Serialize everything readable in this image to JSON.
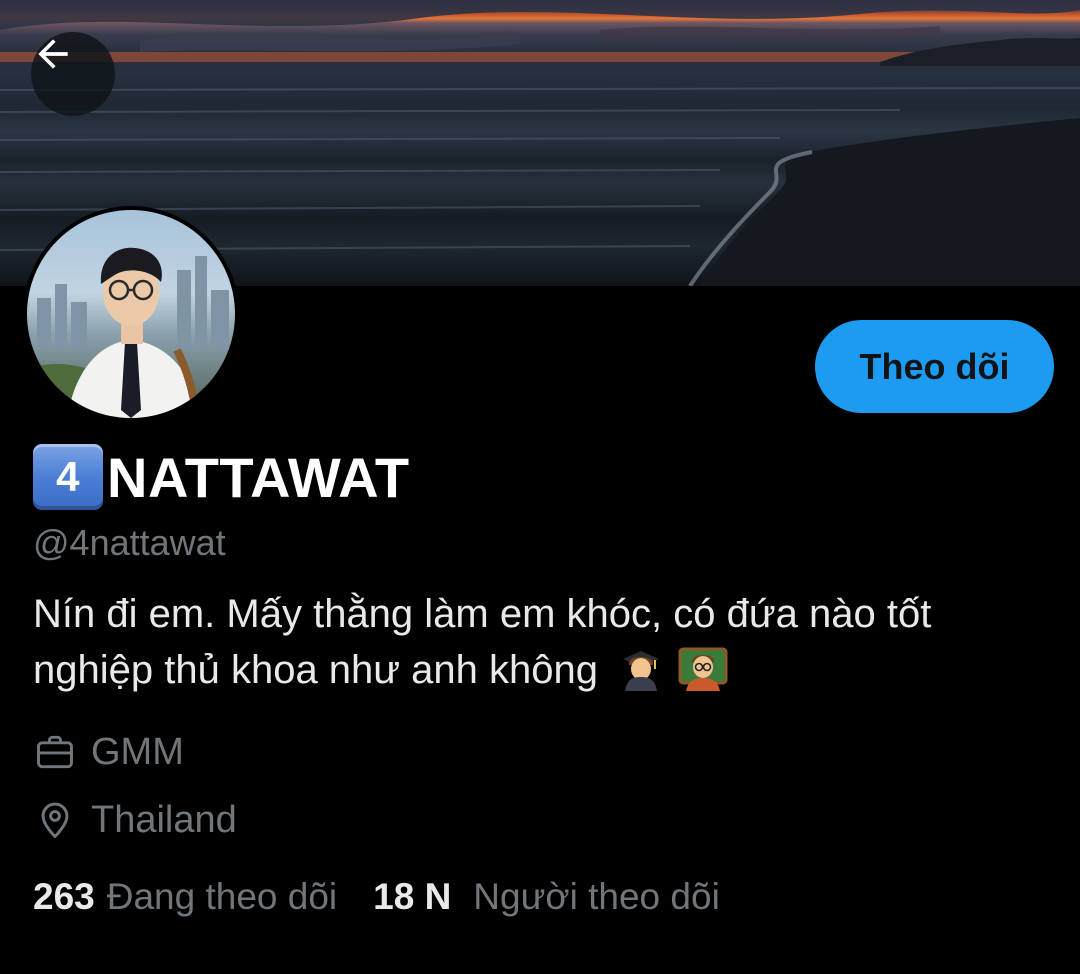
{
  "header": {
    "back_icon": "arrow-left-icon"
  },
  "banner": {
    "scene": "sunset over sea and beach"
  },
  "profile": {
    "follow_label": "Theo dõi",
    "name_badge": "4",
    "display_name": "NATTAWAT",
    "handle": "@4nattawat",
    "bio": "Nín đi em. Mấy thằng làm em khóc, có đứa nào tốt nghiệp thủ khoa như anh không",
    "bio_emojis": [
      "graduate-emoji",
      "teacher-emoji"
    ],
    "work": "GMM",
    "work_icon": "briefcase-icon",
    "location": "Thailand",
    "location_icon": "location-pin-icon"
  },
  "stats": {
    "following_count": "263",
    "following_label": "Đang theo dõi",
    "followers_count": "18 N",
    "followers_label": "Người theo dõi"
  },
  "colors": {
    "background": "#000000",
    "accent": "#1d9bf0",
    "secondary_text": "#71767b",
    "primary_text": "#e7e9ea"
  }
}
